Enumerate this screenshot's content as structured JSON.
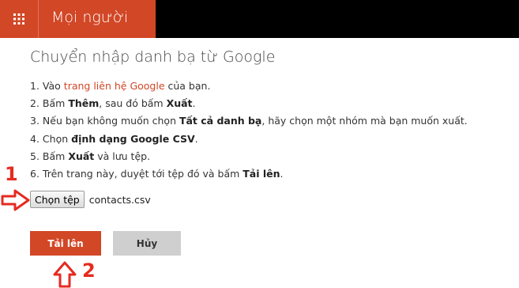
{
  "header": {
    "app_title": "Mọi người",
    "accent_color": "#d24726",
    "bar_color": "#000000",
    "app_launcher_icon": "waffle-grid-icon"
  },
  "page": {
    "heading": "Chuyển nhập danh bạ từ Google"
  },
  "steps": [
    {
      "num": "1.",
      "pre": "Vào ",
      "link": "trang liên hệ Google",
      "post": " của bạn."
    },
    {
      "num": "2.",
      "pre": "Bấm ",
      "b1": "Thêm",
      "mid": ", sau đó bấm ",
      "b2": "Xuất",
      "post": "."
    },
    {
      "num": "3.",
      "pre": "Nếu bạn không muốn chọn ",
      "b1": "Tất cả danh bạ",
      "post": ", hãy chọn một nhóm mà bạn muốn xuất."
    },
    {
      "num": "4.",
      "pre": "Chọn ",
      "b1": "định dạng Google CSV",
      "post": "."
    },
    {
      "num": "5.",
      "pre": "Bấm ",
      "b1": "Xuất",
      "post": " và lưu tệp."
    },
    {
      "num": "6.",
      "pre": "Trên trang này, duyệt tới tệp đó và bấm ",
      "b1": "Tải lên",
      "post": "."
    }
  ],
  "file_input": {
    "button_label": "Chọn tệp",
    "file_name": "contacts.csv"
  },
  "actions": {
    "upload_label": "Tải lên",
    "cancel_label": "Hủy"
  },
  "annotations": {
    "color": "#e52b20",
    "marker_1": "1",
    "marker_2": "2"
  }
}
